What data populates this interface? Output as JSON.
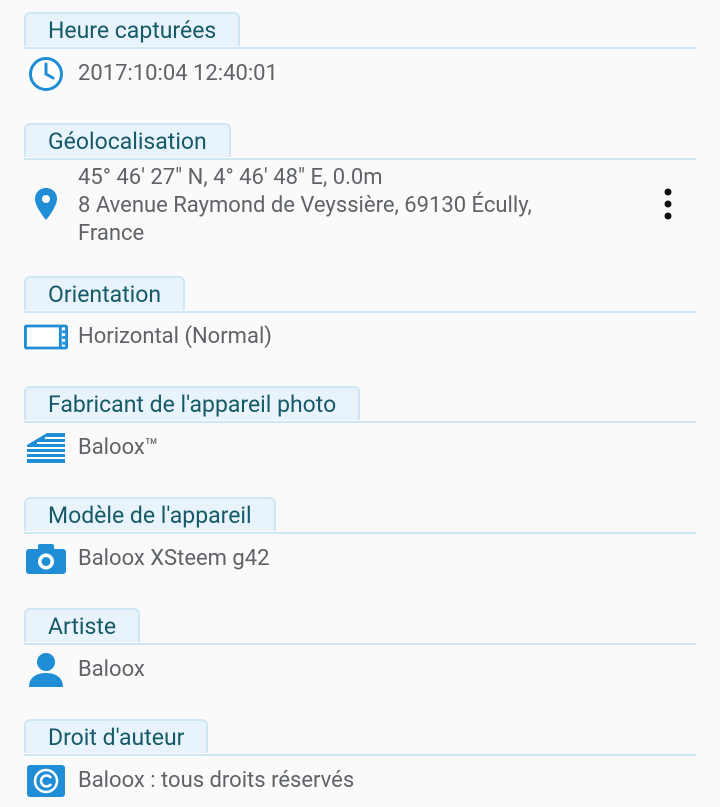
{
  "sections": [
    {
      "title": "Heure capturées",
      "icon": "clock-icon",
      "value": "2017:10:04 12:40:01"
    },
    {
      "title": "Géolocalisation",
      "icon": "location-pin-icon",
      "lines": [
        "45° 46' 27\" N, 4° 46' 48\" E,  0.0m",
        "8 Avenue Raymond de Veyssière, 69130 Écully,",
        "France"
      ]
    },
    {
      "title": "Orientation",
      "icon": "landscape-orientation-icon",
      "value": "Horizontal (Normal)"
    },
    {
      "title": "Fabricant de l'appareil photo",
      "icon": "building-icon",
      "value": "Baloox™"
    },
    {
      "title": "Modèle de l'appareil",
      "icon": "camera-icon",
      "value": "Baloox XSteem g42"
    },
    {
      "title": "Artiste",
      "icon": "person-icon",
      "value": "Baloox"
    },
    {
      "title": "Droit d'auteur",
      "icon": "copyright-icon",
      "value": "Baloox : tous droits réservés"
    }
  ],
  "colors": {
    "accent": "#1f8ed6",
    "tab_bg": "#e8f3fb",
    "tab_border": "#cfe6f5",
    "tab_text": "#155a68",
    "text": "#5f6368"
  }
}
